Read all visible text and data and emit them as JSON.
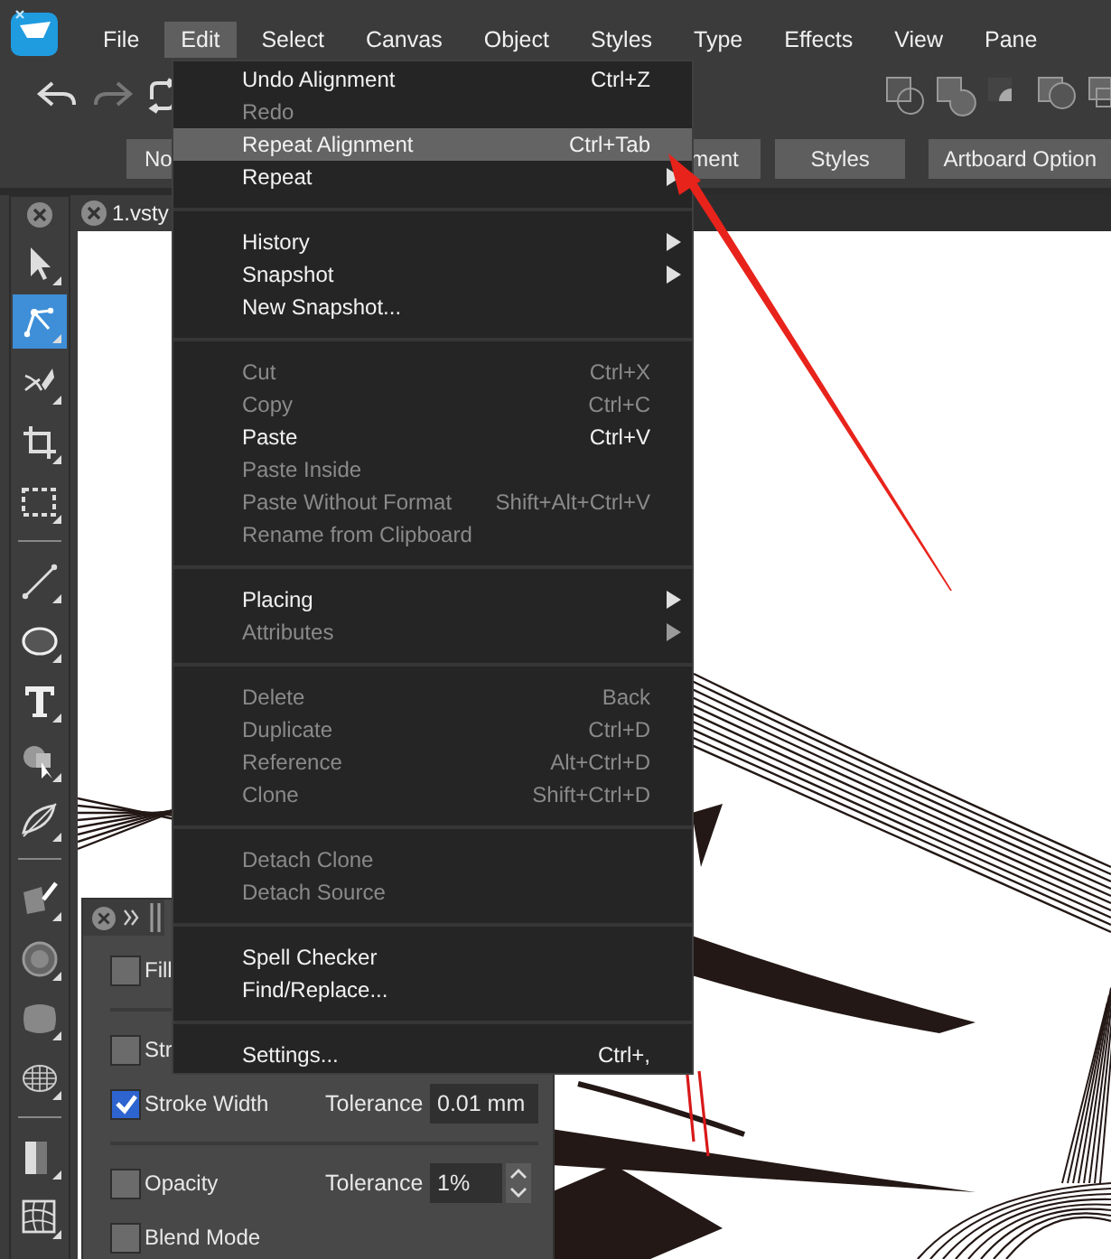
{
  "menubar": {
    "items": [
      {
        "label": "File",
        "selected": false
      },
      {
        "label": "Edit",
        "selected": true
      },
      {
        "label": "Select",
        "selected": false
      },
      {
        "label": "Canvas",
        "selected": false
      },
      {
        "label": "Object",
        "selected": false
      },
      {
        "label": "Styles",
        "selected": false
      },
      {
        "label": "Type",
        "selected": false
      },
      {
        "label": "Effects",
        "selected": false
      },
      {
        "label": "View",
        "selected": false
      },
      {
        "label": "Pane",
        "selected": false
      }
    ]
  },
  "toolbar_buttons": [
    {
      "label": "No"
    },
    {
      "label": "ment"
    },
    {
      "label": "Styles"
    },
    {
      "label": "Artboard Option"
    }
  ],
  "document_tab": {
    "title": "1.vsty"
  },
  "tools": [
    {
      "kind": "pointer",
      "selected": false
    },
    {
      "kind": "node",
      "selected": true
    },
    {
      "kind": "knife",
      "selected": false
    },
    {
      "kind": "crop",
      "selected": false
    },
    {
      "kind": "marquee",
      "selected": false
    },
    {
      "kind": "separator"
    },
    {
      "kind": "line",
      "selected": false
    },
    {
      "kind": "ellipse",
      "selected": false
    },
    {
      "kind": "text",
      "selected": false
    },
    {
      "kind": "shape",
      "selected": false
    },
    {
      "kind": "path",
      "selected": false
    },
    {
      "kind": "separator"
    },
    {
      "kind": "mesh",
      "selected": false
    },
    {
      "kind": "circle",
      "selected": false
    },
    {
      "kind": "rounded",
      "selected": false
    },
    {
      "kind": "sphere",
      "selected": false
    },
    {
      "kind": "separator"
    },
    {
      "kind": "gradient",
      "selected": false
    },
    {
      "kind": "warp",
      "selected": false
    }
  ],
  "edit_menu": {
    "items": [
      {
        "kind": "item",
        "label": "Undo Alignment",
        "shortcut": "Ctrl+Z",
        "disabled": false,
        "highlighted": false,
        "submenu": false
      },
      {
        "kind": "item",
        "label": "Redo",
        "disabled": true,
        "highlighted": false,
        "submenu": false
      },
      {
        "kind": "item",
        "label": "Repeat Alignment",
        "shortcut": "Ctrl+Tab",
        "disabled": false,
        "highlighted": true,
        "submenu": false
      },
      {
        "kind": "item",
        "label": "Repeat",
        "disabled": false,
        "highlighted": false,
        "submenu": true
      },
      {
        "kind": "separator"
      },
      {
        "kind": "item",
        "label": "History",
        "disabled": false,
        "highlighted": false,
        "submenu": true
      },
      {
        "kind": "item",
        "label": "Snapshot",
        "disabled": false,
        "highlighted": false,
        "submenu": true
      },
      {
        "kind": "item",
        "label": "New Snapshot...",
        "disabled": false,
        "highlighted": false,
        "submenu": false
      },
      {
        "kind": "separator"
      },
      {
        "kind": "item",
        "label": "Cut",
        "shortcut": "Ctrl+X",
        "disabled": true,
        "highlighted": false,
        "submenu": false
      },
      {
        "kind": "item",
        "label": "Copy",
        "shortcut": "Ctrl+C",
        "disabled": true,
        "highlighted": false,
        "submenu": false
      },
      {
        "kind": "item",
        "label": "Paste",
        "shortcut": "Ctrl+V",
        "disabled": false,
        "highlighted": false,
        "submenu": false
      },
      {
        "kind": "item",
        "label": "Paste Inside",
        "disabled": true,
        "highlighted": false,
        "submenu": false
      },
      {
        "kind": "item",
        "label": "Paste Without Format",
        "shortcut": "Shift+Alt+Ctrl+V",
        "disabled": true,
        "highlighted": false,
        "submenu": false
      },
      {
        "kind": "item",
        "label": "Rename from Clipboard",
        "disabled": true,
        "highlighted": false,
        "submenu": false
      },
      {
        "kind": "separator"
      },
      {
        "kind": "item",
        "label": "Placing",
        "disabled": false,
        "highlighted": false,
        "submenu": true
      },
      {
        "kind": "item",
        "label": "Attributes",
        "disabled": true,
        "highlighted": false,
        "submenu": true
      },
      {
        "kind": "separator"
      },
      {
        "kind": "item",
        "label": "Delete",
        "shortcut": "Back",
        "disabled": true,
        "highlighted": false,
        "submenu": false
      },
      {
        "kind": "item",
        "label": "Duplicate",
        "shortcut": "Ctrl+D",
        "disabled": true,
        "highlighted": false,
        "submenu": false
      },
      {
        "kind": "item",
        "label": "Reference",
        "shortcut": "Alt+Ctrl+D",
        "disabled": true,
        "highlighted": false,
        "submenu": false
      },
      {
        "kind": "item",
        "label": "Clone",
        "shortcut": "Shift+Ctrl+D",
        "disabled": true,
        "highlighted": false,
        "submenu": false
      },
      {
        "kind": "separator"
      },
      {
        "kind": "item",
        "label": "Detach Clone",
        "disabled": true,
        "highlighted": false,
        "submenu": false
      },
      {
        "kind": "item",
        "label": "Detach Source",
        "disabled": true,
        "highlighted": false,
        "submenu": false
      },
      {
        "kind": "separator"
      },
      {
        "kind": "item",
        "label": "Spell Checker",
        "disabled": false,
        "highlighted": false,
        "submenu": false
      },
      {
        "kind": "item",
        "label": "Find/Replace...",
        "disabled": false,
        "highlighted": false,
        "submenu": false
      },
      {
        "kind": "separator"
      },
      {
        "kind": "item",
        "label": "Settings...",
        "shortcut": "Ctrl+,",
        "disabled": false,
        "highlighted": false,
        "submenu": false
      }
    ]
  },
  "filter_panel": {
    "rows": [
      {
        "kind": "check",
        "label": "Fill",
        "checked": false
      },
      {
        "kind": "separator"
      },
      {
        "kind": "check",
        "label": "Str",
        "checked": false
      },
      {
        "kind": "tolerance",
        "label": "Stroke Width",
        "checked": true,
        "tolerance_label": "Tolerance",
        "value": "0.01 mm"
      },
      {
        "kind": "separator"
      },
      {
        "kind": "spin",
        "label": "Opacity",
        "checked": false,
        "tolerance_label": "Tolerance",
        "value": "1%"
      },
      {
        "kind": "check",
        "label": "Blend Mode",
        "checked": false
      }
    ]
  }
}
